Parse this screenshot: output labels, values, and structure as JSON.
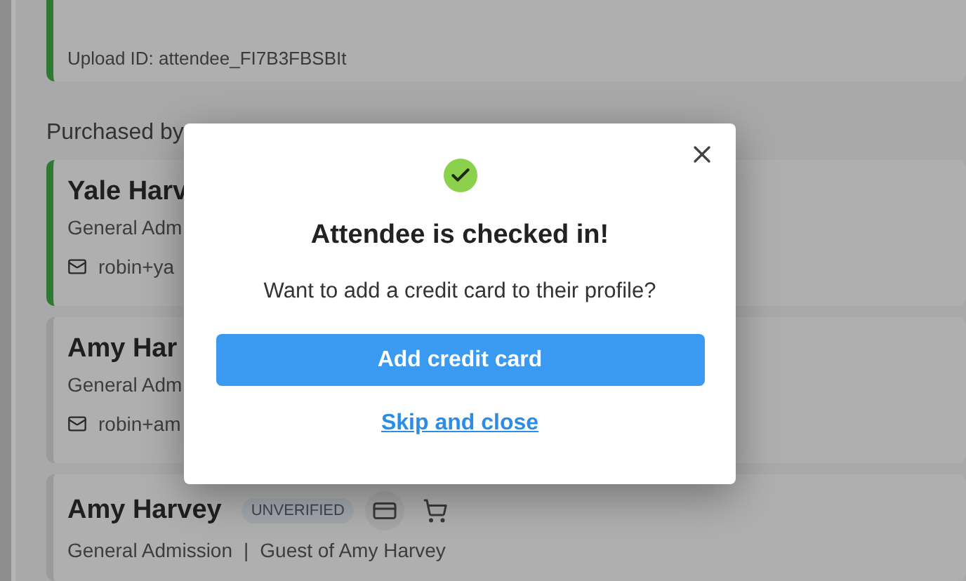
{
  "upload_card": {
    "text": "Upload ID: attendee_FI7B3FBSBIt",
    "checked_in": true
  },
  "section_label": "Purchased by",
  "attendees": [
    {
      "name": "Yale Harv",
      "ticket": "General Adm",
      "email": "robin+ya",
      "checked_in": true
    },
    {
      "name": "Amy Har",
      "ticket": "General Adm",
      "email": "robin+am",
      "checked_in": false
    },
    {
      "name": "Amy Harvey",
      "badge": "UNVERIFIED",
      "ticket": "General Admission",
      "separator": "|",
      "guest_of": "Guest of Amy Harvey",
      "checked_in": false
    }
  ],
  "dialog": {
    "title": "Attendee is checked in!",
    "message": "Want to add a credit card to their profile?",
    "primary_button": "Add credit card",
    "link": "Skip and close"
  }
}
